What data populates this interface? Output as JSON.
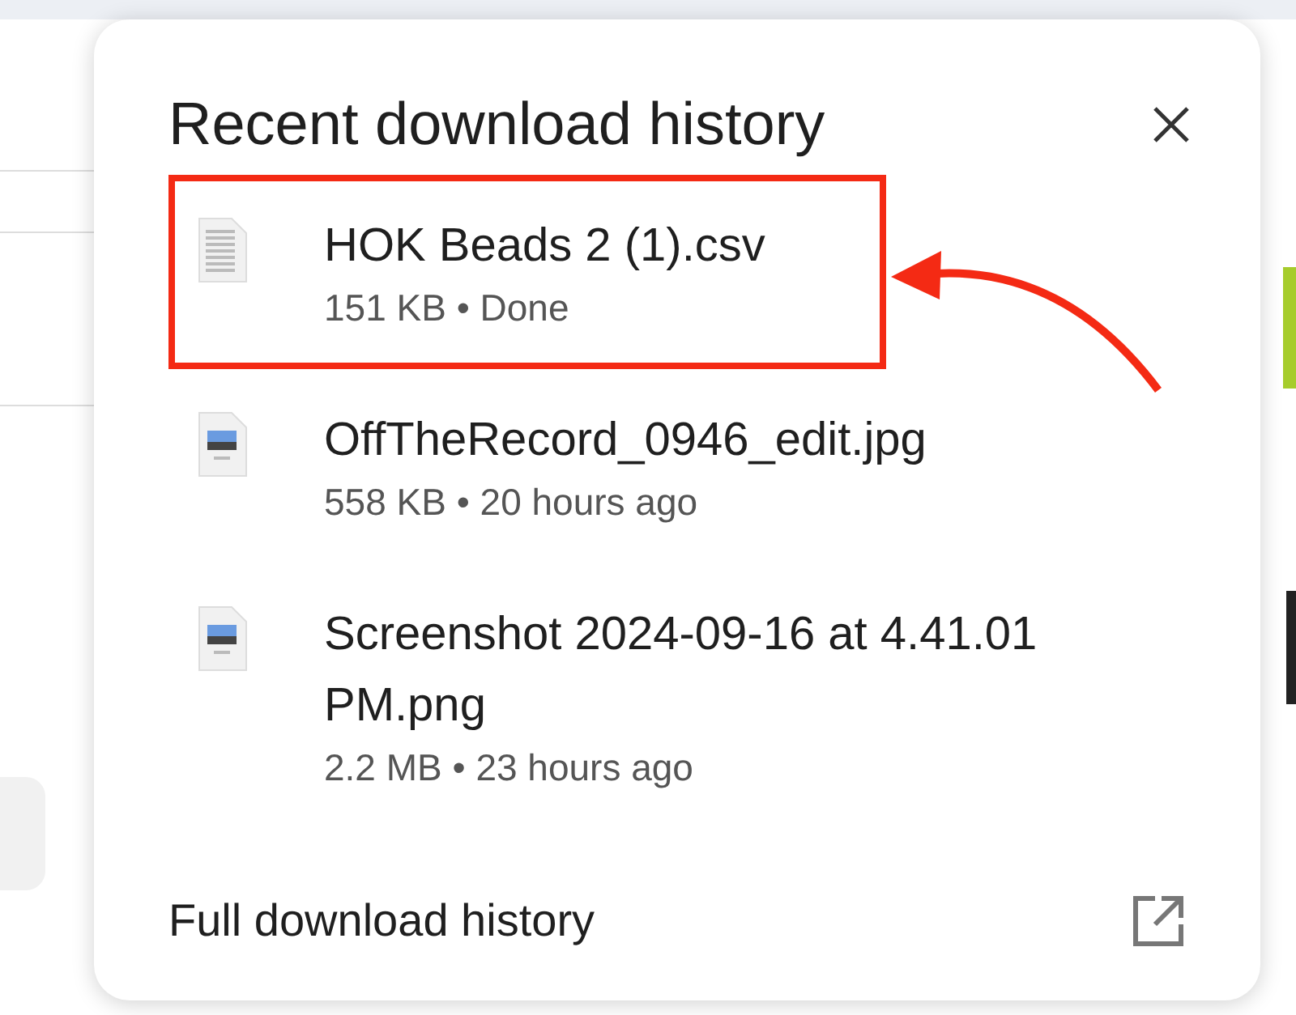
{
  "panel": {
    "title": "Recent download history",
    "items": [
      {
        "name": "HOK Beads 2 (1).csv",
        "meta": "151 KB • Done",
        "kind": "document",
        "highlighted": true
      },
      {
        "name": "OffTheRecord_0946_edit.jpg",
        "meta": "558 KB • 20 hours ago",
        "kind": "image",
        "highlighted": false
      },
      {
        "name": "Screenshot 2024-09-16 at 4.41.01 PM.png",
        "meta": "2.2 MB • 23 hours ago",
        "kind": "image",
        "highlighted": false
      }
    ],
    "footer": {
      "label": "Full download history"
    }
  }
}
